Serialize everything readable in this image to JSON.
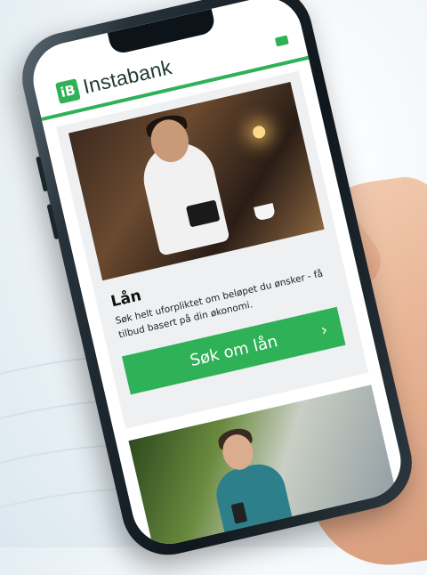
{
  "brand": {
    "logo_mark": "iB",
    "name": "Instabank",
    "accent": "#2fb157"
  },
  "loan_card": {
    "title": "Lån",
    "description": "Søk helt uforpliktet om beløpet du ønsker - få tilbud basert på din økonomi.",
    "cta_label": "Søk om lån",
    "cta_icon": "chevron-right-icon"
  },
  "menu_icon": "menu-icon"
}
